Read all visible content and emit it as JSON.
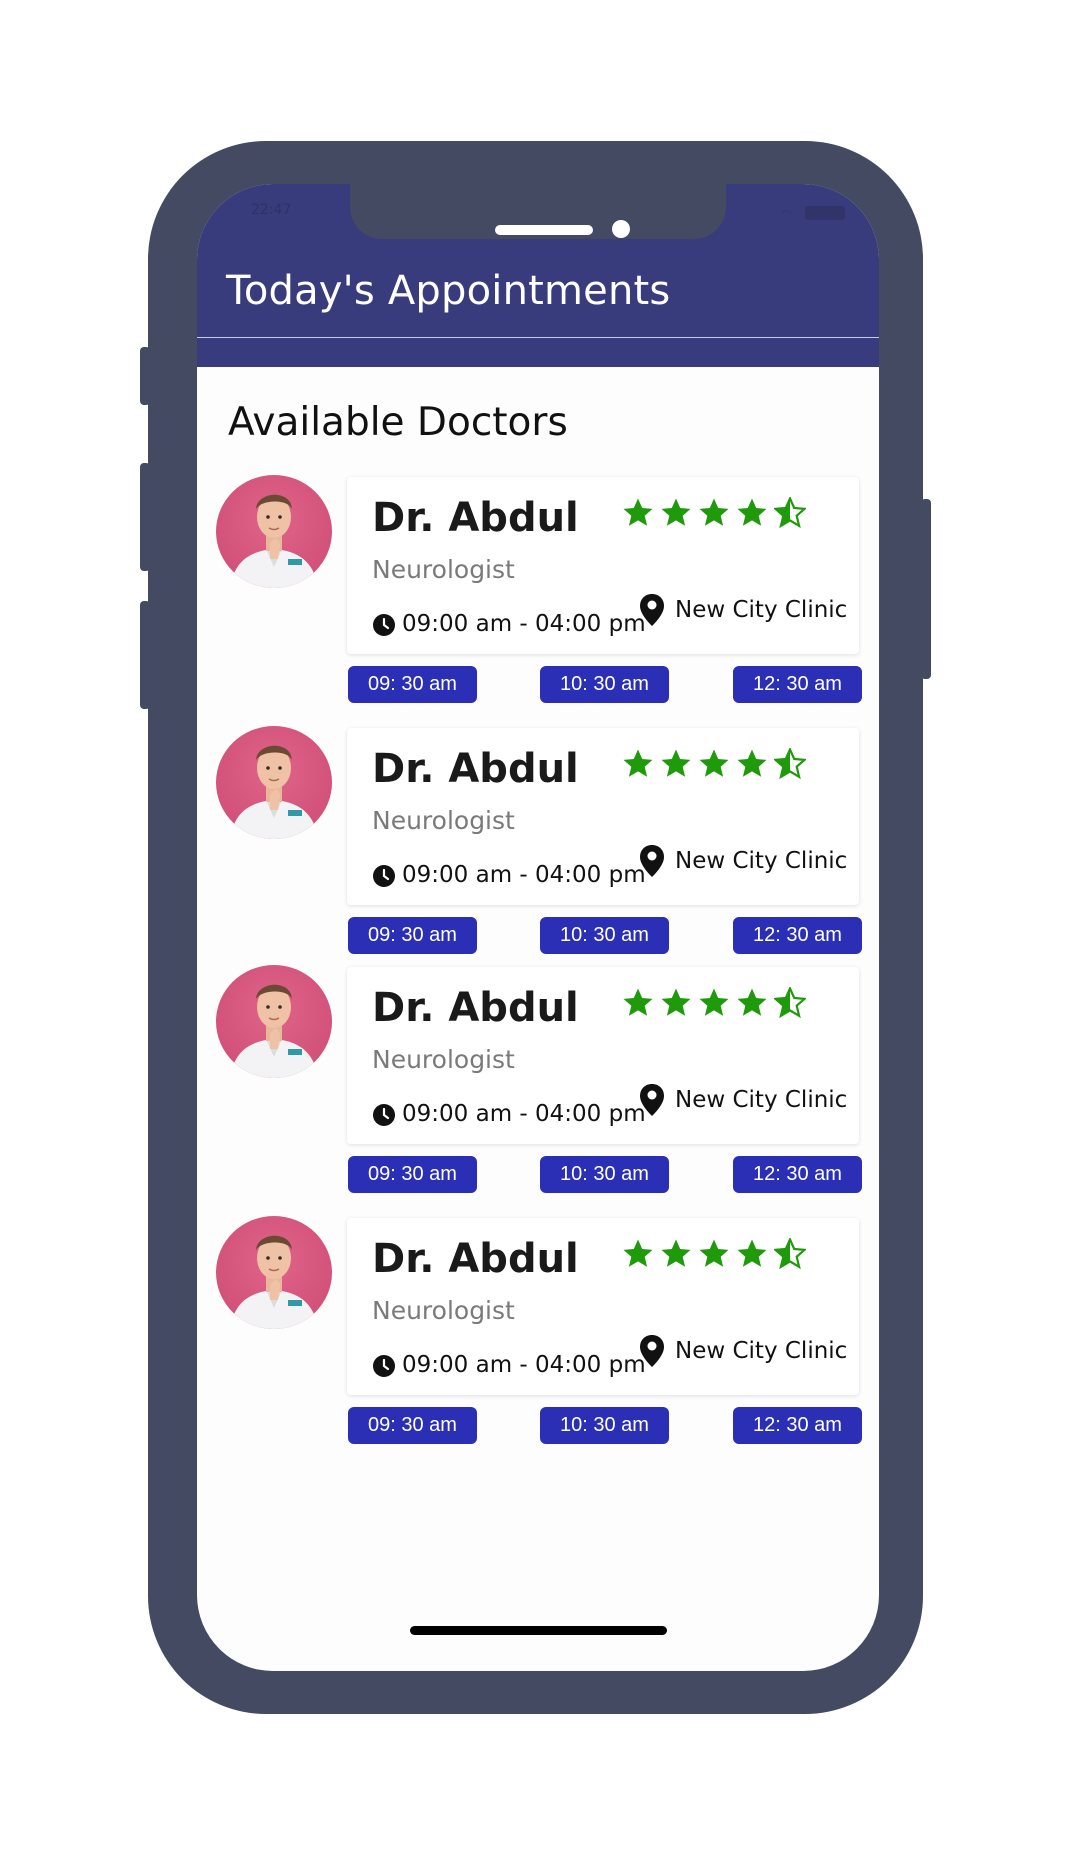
{
  "appbar": {
    "title": "Today's Appointments"
  },
  "section": {
    "title": "Available Doctors"
  },
  "doctors": [
    {
      "name": "Dr. Abdul",
      "specialty": "Neurologist",
      "hours": "09:00 am - 04:00 pm",
      "location": "New City Clinic",
      "rating": 4.5,
      "slots": [
        "09: 30 am",
        "10: 30 am",
        "12: 30 am"
      ]
    },
    {
      "name": "Dr. Abdul",
      "specialty": "Neurologist",
      "hours": "09:00 am - 04:00 pm",
      "location": "New City Clinic",
      "rating": 4.5,
      "slots": [
        "09: 30 am",
        "10: 30 am",
        "12: 30 am"
      ]
    },
    {
      "name": "Dr. Abdul",
      "specialty": "Neurologist",
      "hours": "09:00 am - 04:00 pm",
      "location": "New City Clinic",
      "rating": 4.5,
      "slots": [
        "09: 30 am",
        "10: 30 am",
        "12: 30 am"
      ]
    },
    {
      "name": "Dr. Abdul",
      "specialty": "Neurologist",
      "hours": "09:00 am - 04:00 pm",
      "location": "New City Clinic",
      "rating": 4.5,
      "slots": [
        "09: 30 am",
        "10: 30 am",
        "12: 30 am"
      ]
    }
  ],
  "colors": {
    "appbar": "#383c7c",
    "star": "#1e9a0b",
    "slot": "#2a2fb5",
    "phone_frame": "#434a62"
  },
  "icons": [
    "star-icon",
    "half-star-icon",
    "clock-icon",
    "location-pin-icon"
  ]
}
